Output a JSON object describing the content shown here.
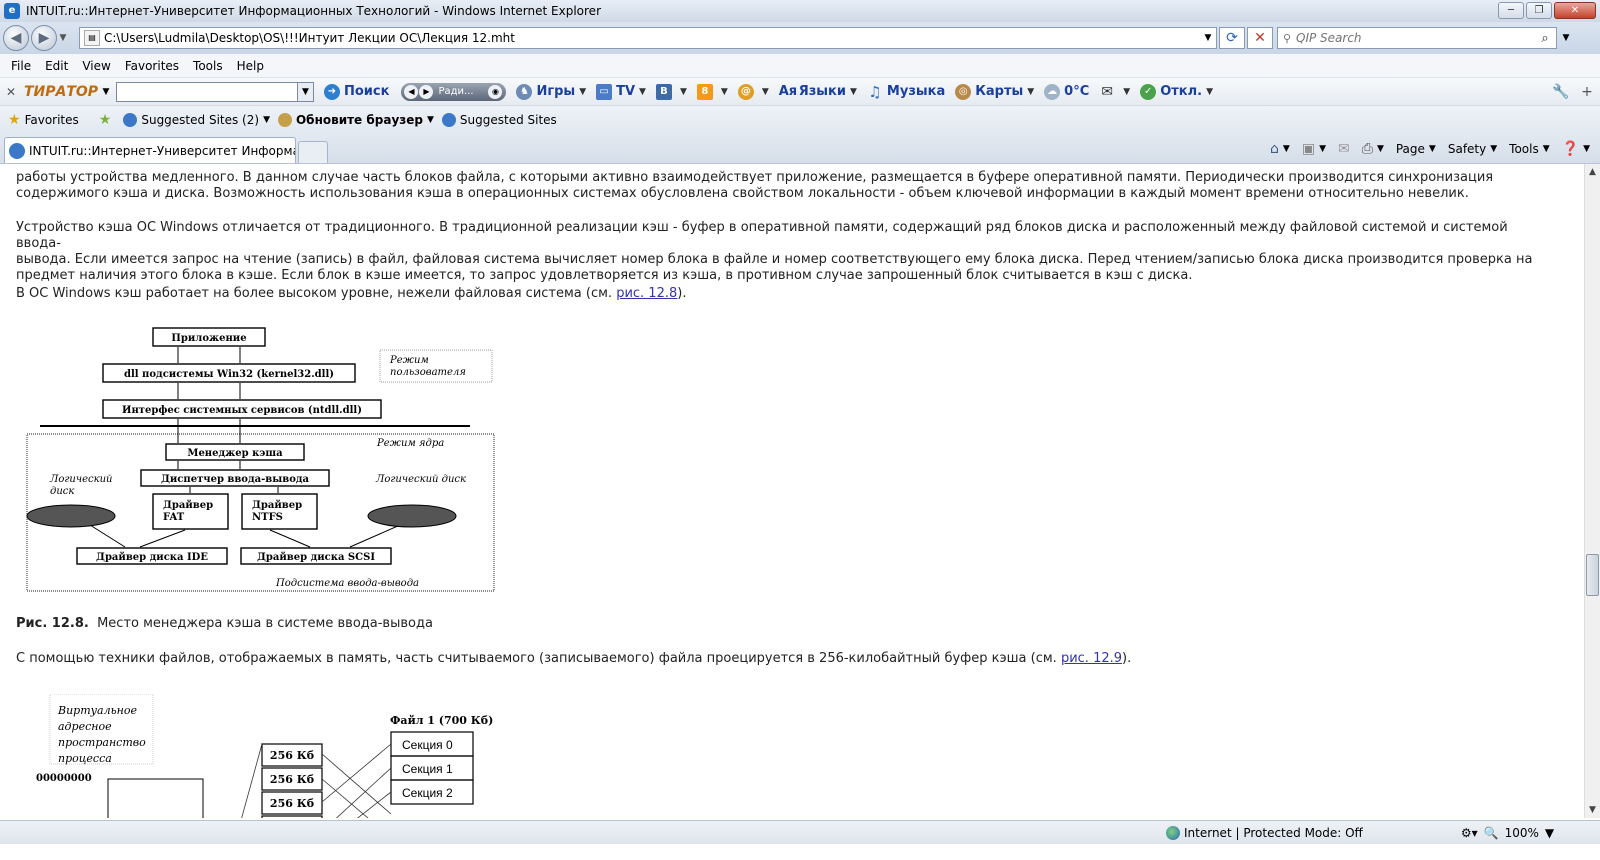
{
  "window": {
    "title": "INTUIT.ru::Интернет-Университет Информационных Технологий - Windows Internet Explorer",
    "controls": [
      "─",
      "❐",
      "✕"
    ]
  },
  "address_bar": {
    "url": "C:\\Users\\Ludmila\\Desktop\\OS\\!!!Интуит Лекции ОС\\Лекция 12.mht",
    "search_placeholder": "QIP Search"
  },
  "menu": [
    "File",
    "Edit",
    "View",
    "Favorites",
    "Tools",
    "Help"
  ],
  "toolbar": {
    "logo": "ТИРАТОР",
    "search": "Поиск",
    "radio": "Ради...",
    "games": "Игры",
    "tv": "TV",
    "vk": "B",
    "ok": "8",
    "mail": "@",
    "languages": "Языки",
    "music": "Музыка",
    "maps": "Карты",
    "weather": "0°C",
    "off": "Откл."
  },
  "favorites_bar": {
    "favorites": "Favorites",
    "item1": "Suggested Sites (2)",
    "item2": "Обновите браузер",
    "item3": "Suggested Sites"
  },
  "tab": {
    "title": "INTUIT.ru::Интернет-Университет Информаци..."
  },
  "command_bar": {
    "page": "Page",
    "safety": "Safety",
    "tools": "Tools"
  },
  "content": {
    "p1_line1": "работы устройства медленного. В данном случае часть блоков файла, с которыми активно взаимодействует приложение, размещается в буфере оперативной памяти. Периодически производится синхронизация",
    "p1_line2": "содержимого кэша и диска. Возможность использования кэша в операционных системах обусловлена свойством локальности - объем ключевой информации в каждый момент времени относительно невелик.",
    "p2_line1": "Устройство кэша ОС Windows отличается от традиционного. В традиционной реализации кэш - буфер в оперативной памяти, содержащий ряд блоков диска и расположенный между файловой системой и системой ввода-",
    "p2_line2": "вывода. Если имеется запрос на чтение (запись) в файл, файловая система вычисляет номер блока в файле и номер соответствующего ему блока диска. Перед чтением/записью блока диска производится проверка на",
    "p2_line3": "предмет наличия этого блока в кэше. Если блок в кэше имеется, то запрос удовлетворяется из кэша, в противном случае запрошенный блок считывается в кэш с диска.",
    "p3_text": "В ОС Windows кэш работает на более высоком уровне, нежели файловая система (см. ",
    "p3_link": "рис. 12.8",
    "p3_end": ").",
    "caption_num": "Рис. 12.8.",
    "caption_text": "Место менеджера кэша в системе ввода-вывода",
    "p4_text": "С помощью техники файлов, отображаемых в память, часть считываемого (записываемого) файла проецируется в 256-килобайтный буфер кэша (см. ",
    "p4_link": "рис. 12.9",
    "p4_end": ")."
  },
  "figure1": {
    "app": "Приложение",
    "win32": "dll подсистемы Win32 (kernel32.dll)",
    "ntdll": "Интерфес системных сервисов (ntdll.dll)",
    "user_mode_1": "Режим",
    "user_mode_2": "пользователя",
    "kernel_mode": "Режим ядра",
    "cache_mgr": "Менеджер кэша",
    "io_mgr": "Диспетчер ввода-вывода",
    "logical_left_1": "Логический",
    "logical_left_2": "диск",
    "logical_right": "Логический диск",
    "fat_1": "Драйвер",
    "fat_2": "FAT",
    "ntfs_1": "Драйвер",
    "ntfs_2": "NTFS",
    "ide": "Драйвер диска IDE",
    "scsi": "Драйвер диска SCSI",
    "io_subsystem": "Подсистема ввода-вывода"
  },
  "figure2": {
    "vas_1": "Виртуальное",
    "vas_2": "адресное",
    "vas_3": "пространство",
    "vas_4": "процесса",
    "addr": "00000000",
    "file": "Файл 1 (700 Кб)",
    "block": "256 Кб",
    "sec0": "Секция 0",
    "sec1": "Секция 1",
    "sec2": "Секция 2"
  },
  "status": {
    "zone": "Internet | Protected Mode: Off",
    "zoom": "100%"
  }
}
